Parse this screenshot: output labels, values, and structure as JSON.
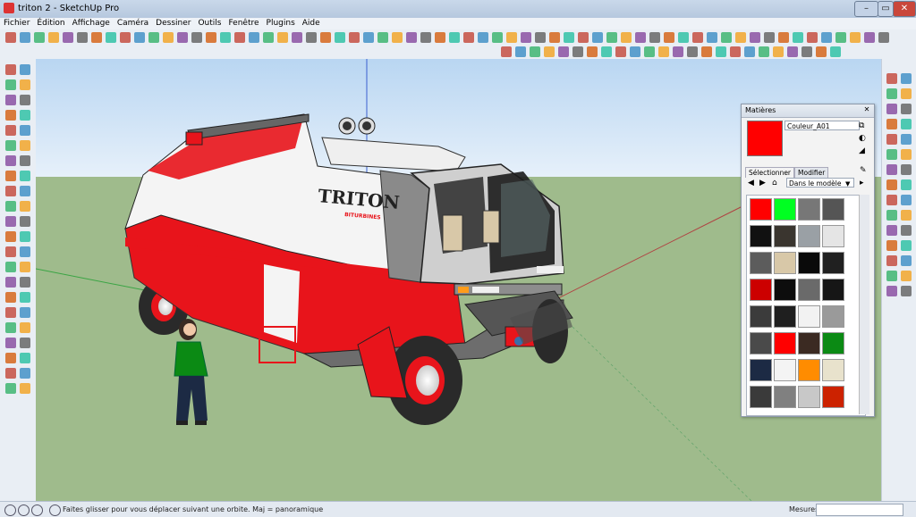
{
  "window": {
    "title": "triton 2 - SketchUp Pro",
    "minimize": "–",
    "maximize": "▭",
    "close": "✕"
  },
  "menu": [
    "Fichier",
    "Édition",
    "Affichage",
    "Caméra",
    "Dessiner",
    "Outils",
    "Fenêtre",
    "Plugins",
    "Aide"
  ],
  "scene": {
    "logo_text": "TRITON",
    "logo_sub": "BITURBINES"
  },
  "materials_panel": {
    "title": "Matières",
    "material_name": "Couleur_A01",
    "current_color": "#ff0000",
    "tab_select": "Sélectionner",
    "tab_edit": "Modifier",
    "library": "Dans le modèle",
    "swatches": [
      "#ff0000",
      "#00ff22",
      "#777777",
      "#555555",
      "#111111",
      "#3a352f",
      "#9aa0a5",
      "#e5e5e5",
      "#5c5c5c",
      "#d8c8a8",
      "#0a0a0a",
      "#202020",
      "#cc0000",
      "#0d0d0d",
      "#6a6a6a",
      "#161616",
      "#3b3b3b",
      "#1f1f1f",
      "#f2f2f2",
      "#9a9a9a",
      "#4a4a4a",
      "#ff0000",
      "#3b2a22",
      "#0b8a14",
      "#1c2a44",
      "#f4f4f4",
      "#ff8c00",
      "#e8e2cc",
      "#3a3a3a",
      "#808080",
      "#c8c8c8",
      "#cc2200"
    ]
  },
  "status": {
    "message": "Faites glisser pour vous déplacer suivant une orbite.  Maj = panoramique",
    "measure_label": "Mesures",
    "measure_value": ""
  },
  "colors": {
    "sky": "#cfe3f7",
    "ground": "#9fbb8c",
    "vehicle_red": "#e8141b",
    "vehicle_white": "#f4f4f4",
    "tire": "#2a2a2a"
  }
}
